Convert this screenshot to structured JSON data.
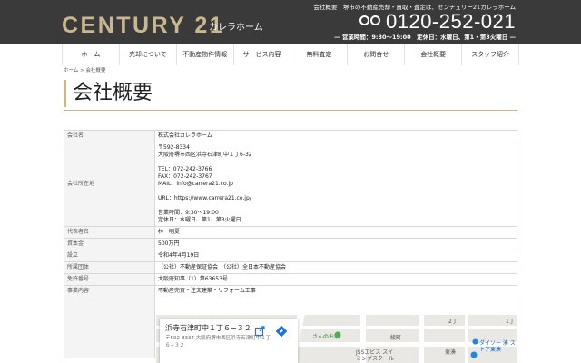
{
  "header": {
    "logo": "CENTURY 21",
    "logo_sub": "カレラホーム",
    "tagline": "会社概要｜堺市の不動産売却・買取・査定は、センチュリー21カレラホーム",
    "phone": "0120-252-021",
    "hours": "— 営業時間：9:30〜19:00　定休日：水曜日、第1・第3火曜日 —",
    "icon": "freedial-icon"
  },
  "nav": {
    "items": [
      "ホーム",
      "売却について",
      "不動産物件情報",
      "サービス内容",
      "無料査定",
      "お問合せ",
      "会社概要",
      "スタッフ紹介"
    ]
  },
  "breadcrumb": "ホーム > 会社概要",
  "page_title": "会社概要",
  "company": {
    "name_label": "会社名",
    "name": "株式会社カレラホーム",
    "address_label": "会社所在地",
    "address_lines": [
      "〒592-8334",
      "大阪府堺市西区浜寺石津町中１丁6-32",
      "",
      "TEL：072-242-3766",
      "FAX：072-242-3767",
      "MAIL：info@carrera21.co.jp",
      "",
      "URL：https://www.carrera21.co.jp/",
      "",
      "営業時間：9:30〜19:00",
      "定休日：水曜日、第1、第3火曜日"
    ],
    "rep_label": "代表者名",
    "rep": "林　明夏",
    "capital_label": "資本金",
    "capital": "500万円",
    "founded_label": "設立",
    "founded": "令和4年4月19日",
    "org_label": "所属団体",
    "org": "（公社）不動産保証協会　（公社）全日本不動産協会",
    "license_label": "免許番号",
    "license": "大阪府知事（1）第63653号",
    "business_label": "事業内容",
    "business": "不動産売買・注文建築・リフォーム工事"
  },
  "map": {
    "card_title": "浜寺石津町中１丁６−３２",
    "card_address": "〒592-8334 大阪府堺市西区浜寺石津町中１丁６−３２",
    "labels": {
      "omise": "さんのお茶",
      "school": "JSSエビス スイミングスクール",
      "ayano": "綾町",
      "higashi": "東湊",
      "daikoku": "ダイソー 湊 ストア東湊",
      "chome1": "1丁",
      "chome2": "2丁"
    }
  }
}
